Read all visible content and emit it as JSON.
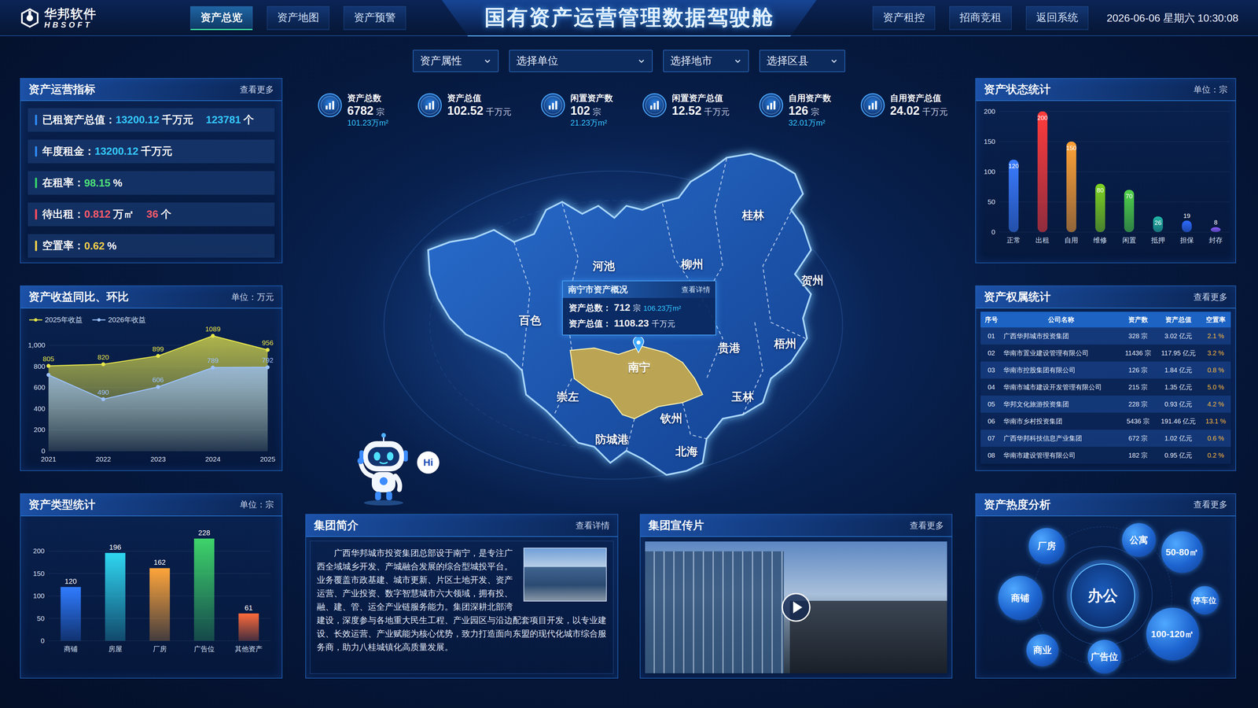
{
  "header": {
    "logo": {
      "name": "华邦软件",
      "sub": "HBSOFT"
    },
    "title": "国有资产运营管理数据驾驶舱",
    "left_tabs": [
      {
        "label": "资产总览",
        "selected": true
      },
      {
        "label": "资产地图",
        "selected": false
      },
      {
        "label": "资产预警",
        "selected": false
      }
    ],
    "right_tabs": [
      {
        "label": "资产租控",
        "selected": false
      },
      {
        "label": "招商竞租",
        "selected": false
      },
      {
        "label": "返回系统",
        "selected": false
      }
    ],
    "datetime": "2026-06-06 星期六 10:30:08"
  },
  "filters": [
    {
      "label": "资产属性"
    },
    {
      "label": "选择单位"
    },
    {
      "label": "选择地市"
    },
    {
      "label": "选择区县"
    }
  ],
  "operation": {
    "title": "资产运营指标",
    "more": "查看更多",
    "rows": [
      {
        "label": "已租资产总值：",
        "indicator": "#2f8cff",
        "values": [
          {
            "value": "13200.12",
            "unit": "千万元",
            "color": "#35c8ff"
          },
          {
            "value": "123781",
            "unit": "个",
            "color": "#35c8ff"
          }
        ]
      },
      {
        "label": "年度租金：",
        "indicator": "#2f8cff",
        "values": [
          {
            "value": "13200.12",
            "unit": "千万元",
            "color": "#35c8ff"
          }
        ]
      },
      {
        "label": "在租率：",
        "indicator": "#34d36b",
        "values": [
          {
            "value": "98.15",
            "unit": "%",
            "color": "#4ee07a"
          }
        ]
      },
      {
        "label": "待出租：",
        "indicator": "#ff4d5e",
        "values": [
          {
            "value": "0.812",
            "unit": "万㎡",
            "color": "#ff5a6a"
          },
          {
            "value": "36",
            "unit": "个",
            "color": "#ff5a6a"
          }
        ]
      },
      {
        "label": "空置率：",
        "indicator": "#f5d04a",
        "values": [
          {
            "value": "0.62",
            "unit": "%",
            "color": "#f5d04a"
          }
        ]
      }
    ]
  },
  "income": {
    "title": "资产收益同比、环比",
    "unit": "单位：万元",
    "y_ticks": [
      {
        "value": 0,
        "label": "0"
      },
      {
        "value": 200,
        "label": "200"
      },
      {
        "value": 400,
        "label": "400"
      },
      {
        "value": 600,
        "label": "600"
      },
      {
        "value": 800,
        "label": "800"
      },
      {
        "value": 1000,
        "label": "1,000"
      }
    ],
    "x_labels": [
      "2021",
      "2022",
      "2023",
      "2024",
      "2025"
    ],
    "series": [
      {
        "name": "2025年收益",
        "color": "#e6e64a",
        "values": [
          805,
          820,
          899,
          1089,
          956
        ],
        "labels": [
          "805",
          "820",
          "899",
          "1089",
          "956"
        ]
      },
      {
        "name": "2026年收益",
        "color": "#9cc2ff",
        "values": [
          720,
          490,
          606,
          789,
          792
        ],
        "labels": [
          "",
          "490",
          "606",
          "789",
          "792"
        ]
      }
    ]
  },
  "types": {
    "title": "资产类型统计",
    "unit": "单位：宗",
    "ticks": [
      {
        "value": 0,
        "label": "0"
      },
      {
        "value": 50,
        "label": "50"
      },
      {
        "value": 100,
        "label": "100"
      },
      {
        "value": 150,
        "label": "150"
      },
      {
        "value": 200,
        "label": "200"
      }
    ],
    "bars": [
      {
        "label": "商铺",
        "value": 120,
        "text": "120",
        "color": "#2f7bff"
      },
      {
        "label": "房屋",
        "value": 196,
        "text": "196",
        "color": "#2fd6f0"
      },
      {
        "label": "厂房",
        "value": 162,
        "text": "162",
        "color": "#ffa53a"
      },
      {
        "label": "广告位",
        "value": 228,
        "text": "228",
        "color": "#3ed36a"
      },
      {
        "label": "其他资产",
        "value": 61,
        "text": "61",
        "color": "#ff6a3a"
      }
    ]
  },
  "kpis": [
    {
      "label": "资产总数",
      "value": "6782",
      "unit": "宗",
      "sub": "101.23万m²"
    },
    {
      "label": "资产总值",
      "value": "102.52",
      "unit": "千万元",
      "sub": ""
    },
    {
      "label": "闲置资产数",
      "value": "102",
      "unit": "宗",
      "sub": "21.23万m²"
    },
    {
      "label": "闲置资产总值",
      "value": "12.52",
      "unit": "千万元",
      "sub": ""
    },
    {
      "label": "自用资产数",
      "value": "126",
      "unit": "宗",
      "sub": "32.01万m²"
    },
    {
      "label": "自用资产总值",
      "value": "24.02",
      "unit": "千万元",
      "sub": ""
    }
  ],
  "map": {
    "cities": [
      {
        "name": "桂林",
        "selected": false
      },
      {
        "name": "河池",
        "selected": false
      },
      {
        "name": "柳州",
        "selected": false
      },
      {
        "name": "贺州",
        "selected": false
      },
      {
        "name": "百色",
        "selected": false
      },
      {
        "name": "贵港",
        "selected": false
      },
      {
        "name": "梧州",
        "selected": false
      },
      {
        "name": "南宁",
        "selected": true
      },
      {
        "name": "崇左",
        "selected": false
      },
      {
        "name": "玉林",
        "selected": false
      },
      {
        "name": "钦州",
        "selected": false
      },
      {
        "name": "防城港",
        "selected": false
      },
      {
        "name": "北海",
        "selected": false
      }
    ],
    "tooltip": {
      "title": "南宁市资产概况",
      "action": "查看详情",
      "rows": [
        {
          "label": "资产总数：",
          "value": "712",
          "unit": "宗",
          "extra": "106.23万m²"
        },
        {
          "label": "资产总值：",
          "value": "1108.23",
          "unit": "千万元",
          "extra": ""
        }
      ]
    },
    "assistant": {
      "greeting": "Hi"
    }
  },
  "intro": {
    "title": "集团简介",
    "more": "查看详情",
    "text": "广西华邦城市投资集团总部设于南宁，是专注广西全域城乡开发、产城融合发展的综合型城投平台。业务覆盖市政基建、城市更新、片区土地开发、资产运营、产业投资、数字智慧城市六大领域，拥有投、融、建、管、运全产业链服务能力。集团深耕北部湾建设，深度参与各地重大民生工程、产业园区与沿边配套项目开发，以专业建设、长效运营、产业赋能为核心优势，致力打造面向东盟的现代化城市综合服务商，助力八桂城镇化高质量发展。"
  },
  "video": {
    "title": "集团宣传片",
    "more": "查看更多"
  },
  "status": {
    "title": "资产状态统计",
    "unit": "单位：宗",
    "ticks": [
      {
        "value": 0,
        "label": "0"
      },
      {
        "value": 50,
        "label": "50"
      },
      {
        "value": 100,
        "label": "100"
      },
      {
        "value": 150,
        "label": "150"
      },
      {
        "value": 200,
        "label": "200"
      }
    ],
    "bars": [
      {
        "label": "正常",
        "value": 120,
        "text": "120",
        "color": "#3a7bff"
      },
      {
        "label": "出租",
        "value": 200,
        "text": "200",
        "color": "#ff3b3b"
      },
      {
        "label": "自用",
        "value": 150,
        "text": "150",
        "color": "#ffa135"
      },
      {
        "label": "维修",
        "value": 80,
        "text": "80",
        "color": "#7ed321"
      },
      {
        "label": "闲置",
        "value": 70,
        "text": "70",
        "color": "#4fd34a"
      },
      {
        "label": "抵押",
        "value": 26,
        "text": "26",
        "color": "#22b8a8"
      },
      {
        "label": "担保",
        "value": 19,
        "text": "19",
        "color": "#2d6bff"
      },
      {
        "label": "封存",
        "value": 8,
        "text": "8",
        "color": "#8a5cff"
      }
    ]
  },
  "ownership": {
    "title": "资产权属统计",
    "more": "查看更多",
    "columns": [
      "序号",
      "公司名称",
      "资产数",
      "资产总值",
      "空置率"
    ],
    "rows": [
      {
        "no": "01",
        "company": "广西华邦城市投资集团",
        "count": "328 宗",
        "value": "3.02 亿元",
        "vacancy": "2.1 %"
      },
      {
        "no": "02",
        "company": "华南市置业建设管理有限公司",
        "count": "11436 宗",
        "value": "117.95 亿元",
        "vacancy": "3.2 %"
      },
      {
        "no": "03",
        "company": "华南市控股集团有限公司",
        "count": "126 宗",
        "value": "1.84 亿元",
        "vacancy": "0.8 %"
      },
      {
        "no": "04",
        "company": "华南市城市建设开发管理有限公司",
        "count": "215 宗",
        "value": "1.35 亿元",
        "vacancy": "5.0 %"
      },
      {
        "no": "05",
        "company": "华邦文化旅游投资集团",
        "count": "228 宗",
        "value": "0.93 亿元",
        "vacancy": "4.2 %"
      },
      {
        "no": "06",
        "company": "华南市乡村投资集团",
        "count": "5436 宗",
        "value": "191.46 亿元",
        "vacancy": "13.1 %"
      },
      {
        "no": "07",
        "company": "广西华邦科技信息产业集团",
        "count": "672 宗",
        "value": "1.02 亿元",
        "vacancy": "0.6 %"
      },
      {
        "no": "08",
        "company": "华南市建设管理有限公司",
        "count": "182 宗",
        "value": "0.95 亿元",
        "vacancy": "0.2 %"
      }
    ]
  },
  "heat": {
    "title": "资产热度分析",
    "more": "查看更多",
    "bubbles": [
      {
        "label": "厂房",
        "level": 0.23,
        "featured": false
      },
      {
        "label": "公寓",
        "level": 0.18,
        "featured": false
      },
      {
        "label": "50-80㎡",
        "level": 0.36,
        "featured": false
      },
      {
        "label": "商铺",
        "level": 0.42,
        "featured": false
      },
      {
        "label": "办公",
        "level": 0.9,
        "featured": true
      },
      {
        "label": "停车位",
        "level": 0.05,
        "featured": false
      },
      {
        "label": "100-120㎡",
        "level": 0.62,
        "featured": false
      },
      {
        "label": "商业",
        "level": 0.14,
        "featured": false
      },
      {
        "label": "广告位",
        "level": 0.18,
        "featured": false
      }
    ]
  }
}
